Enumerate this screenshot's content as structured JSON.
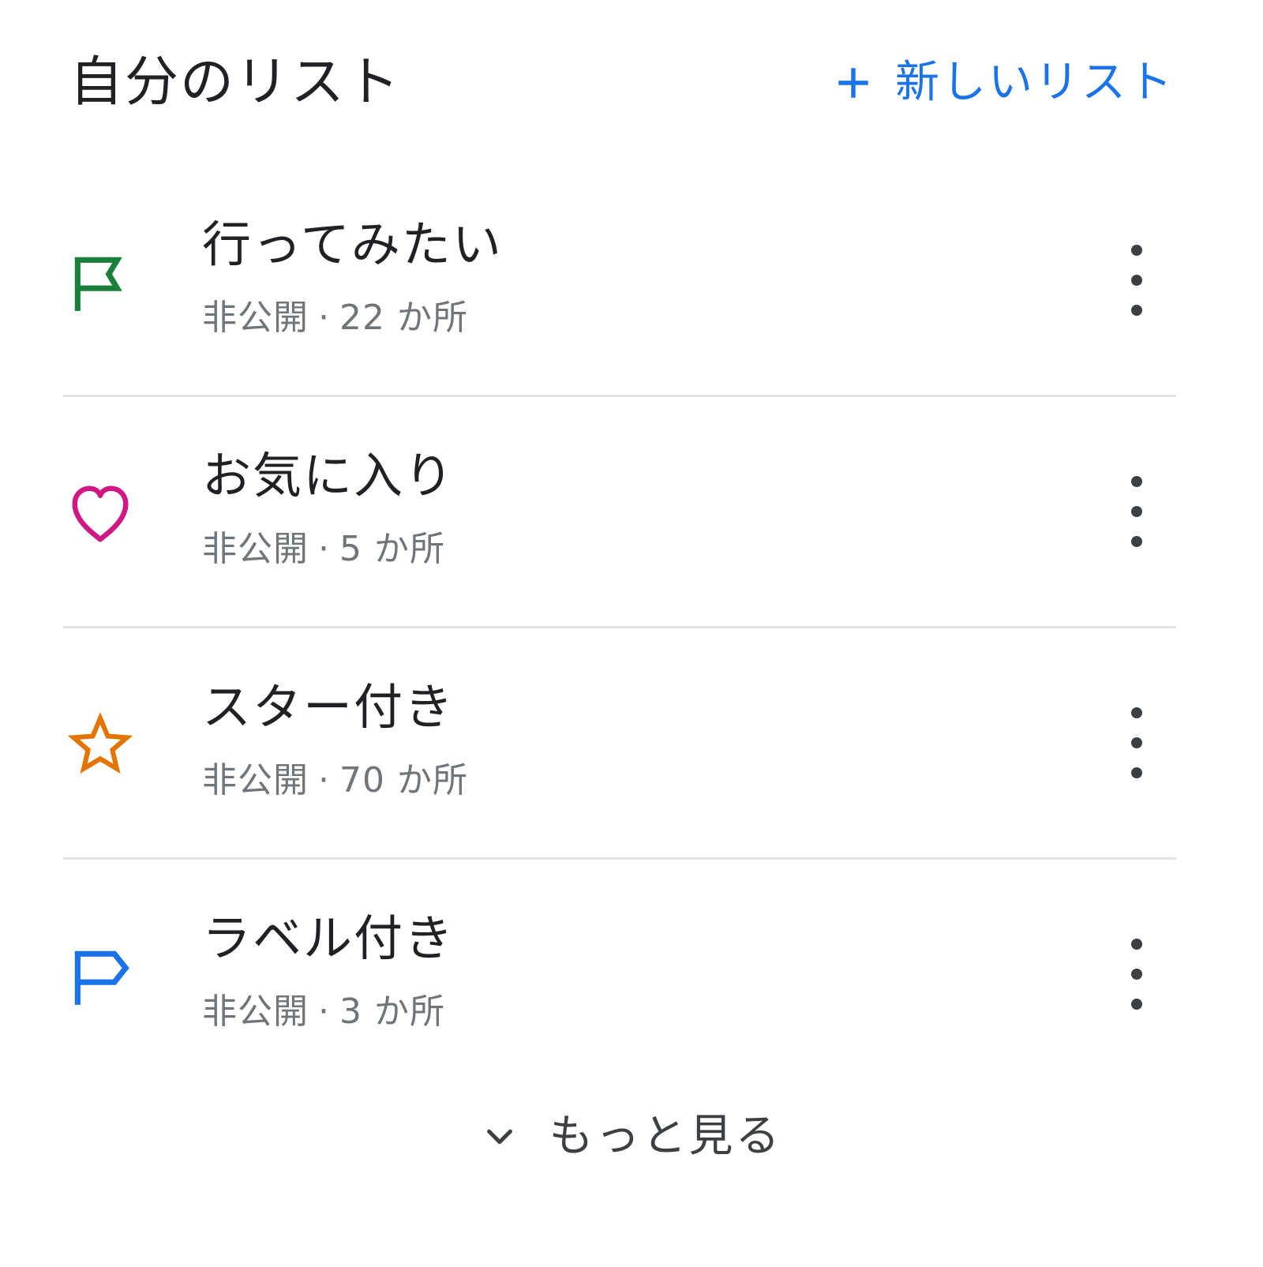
{
  "header": {
    "title": "自分のリスト",
    "new_list_label": "新しいリスト",
    "new_list_icon": "plus-icon"
  },
  "lists": [
    {
      "name": "行ってみたい",
      "visibility": "非公開",
      "count": "22 か所",
      "icon": "flag-icon",
      "icon_color": "#188038"
    },
    {
      "name": "お気に入り",
      "visibility": "非公開",
      "count": "5 か所",
      "icon": "heart-icon",
      "icon_color": "#d01884"
    },
    {
      "name": "スター付き",
      "visibility": "非公開",
      "count": "70 か所",
      "icon": "star-icon",
      "icon_color": "#e37400"
    },
    {
      "name": "ラベル付き",
      "visibility": "非公開",
      "count": "3 か所",
      "icon": "label-flag-icon",
      "icon_color": "#1a73e8"
    }
  ],
  "meta_separator": "·",
  "more_icon": "more-vert-icon",
  "show_more": {
    "label": "もっと見る",
    "icon": "chevron-down-icon"
  },
  "colors": {
    "accent": "#1a73e8",
    "text_primary": "#202124",
    "text_secondary": "#70757a",
    "divider": "#e3e3e3"
  }
}
